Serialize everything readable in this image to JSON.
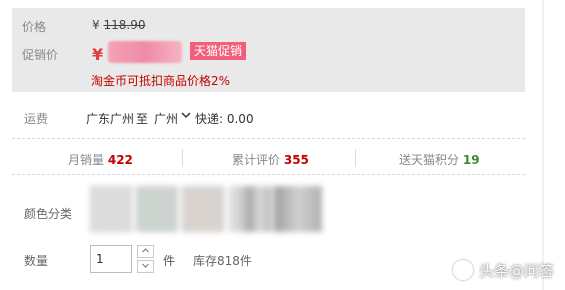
{
  "price": {
    "label": "价格",
    "yen": "¥",
    "original_value": "118.90"
  },
  "promo": {
    "label": "促销价",
    "yen": "¥",
    "tag": "天猫促销",
    "taobao_coin": "淘金币可抵扣商品价格2%"
  },
  "shipping": {
    "label": "运费",
    "origin": "广东广州",
    "to": "至",
    "destination": "广州",
    "chevron_icon": "chevron-down-icon",
    "fee": "快递: 0.00"
  },
  "stats": {
    "monthly_sales_label": "月销量",
    "monthly_sales_value": "422",
    "reviews_label": "累计评价",
    "reviews_value": "355",
    "points_label": "送天猫积分",
    "points_value": "19"
  },
  "color": {
    "label": "颜色分类"
  },
  "quantity": {
    "label": "数量",
    "value": "1",
    "unit": "件",
    "stock": "库存818件"
  },
  "watermark": {
    "text": "头条@问答",
    "icon": "logo-icon"
  },
  "colors": {
    "accent_red": "#c40000",
    "promo_tag": "#f1607b",
    "green": "#3c8a2e",
    "panel_bg": "#e9e9e9"
  }
}
